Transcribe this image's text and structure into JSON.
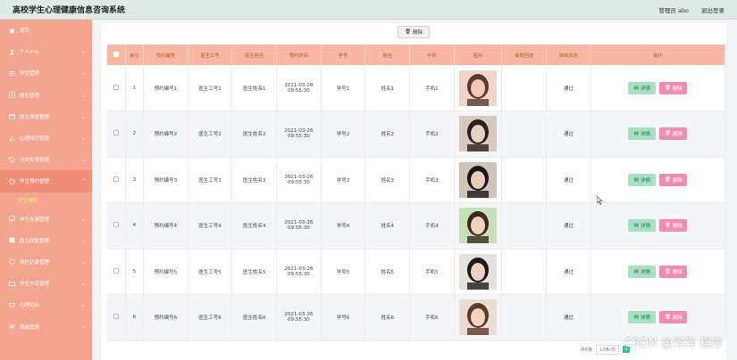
{
  "header": {
    "title": "高校学生心理健康信息咨询系统",
    "user": "管理员 abo",
    "logout": "退出登录"
  },
  "sidebar": {
    "items": [
      {
        "label": "首页",
        "icon": "home-icon"
      },
      {
        "label": "个人中心",
        "icon": "user-icon"
      },
      {
        "label": "学生管理",
        "icon": "list-icon"
      },
      {
        "label": "医生管理",
        "icon": "doctor-icon"
      },
      {
        "label": "医生排班管理",
        "icon": "calendar-icon"
      },
      {
        "label": "心理知识管理",
        "icon": "chart-icon"
      },
      {
        "label": "分类标签管理",
        "icon": "tag-icon"
      },
      {
        "label": "学生预约管理",
        "icon": "clock-icon",
        "open": true
      },
      {
        "label": "学生反馈管理",
        "icon": "message-icon"
      },
      {
        "label": "医生回复管理",
        "icon": "reply-icon"
      },
      {
        "label": "相约记录管理",
        "icon": "record-icon"
      },
      {
        "label": "学生分享管理",
        "icon": "share-icon"
      },
      {
        "label": "心理论坛",
        "icon": "forum-icon"
      },
      {
        "label": "系统管理",
        "icon": "settings-icon"
      }
    ],
    "open_sub": "学生预约"
  },
  "toolbar": {
    "delete_label": "删除"
  },
  "table": {
    "columns": [
      "索引",
      "预约编号",
      "医生工号",
      "医生姓名",
      "预约时间",
      "学号",
      "姓名",
      "手机",
      "图片",
      "审核回复",
      "审核状态",
      "操作"
    ],
    "rows": [
      {
        "index": "1",
        "booking_no": "预约编号1",
        "doctor_id": "医生工号1",
        "doctor_name": "医生姓名1",
        "time": "2021-03-26 09:55:30",
        "student_no": "学号1",
        "name": "姓名1",
        "phone": "手机1",
        "reply": "",
        "status": "通过"
      },
      {
        "index": "2",
        "booking_no": "预约编号2",
        "doctor_id": "医生工号2",
        "doctor_name": "医生姓名2",
        "time": "2021-03-26 09:55:30",
        "student_no": "学号2",
        "name": "姓名2",
        "phone": "手机2",
        "reply": "",
        "status": "通过"
      },
      {
        "index": "3",
        "booking_no": "预约编号3",
        "doctor_id": "医生工号3",
        "doctor_name": "医生姓名3",
        "time": "2021-03-26 09:55:30",
        "student_no": "学号3",
        "name": "姓名3",
        "phone": "手机3",
        "reply": "",
        "status": "通过"
      },
      {
        "index": "4",
        "booking_no": "预约编号4",
        "doctor_id": "医生工号4",
        "doctor_name": "医生姓名4",
        "time": "2021-03-26 09:55:30",
        "student_no": "学号4",
        "name": "姓名4",
        "phone": "手机4",
        "reply": "",
        "status": "通过"
      },
      {
        "index": "5",
        "booking_no": "预约编号5",
        "doctor_id": "医生工号5",
        "doctor_name": "医生姓名5",
        "time": "2021-03-26 09:55:30",
        "student_no": "学号5",
        "name": "姓名5",
        "phone": "手机5",
        "reply": "",
        "status": "通过"
      },
      {
        "index": "6",
        "booking_no": "预约编号6",
        "doctor_id": "医生工号6",
        "doctor_name": "医生姓名6",
        "time": "2021-03-26 09:55:30",
        "student_no": "学号6",
        "name": "姓名6",
        "phone": "手机6",
        "reply": "",
        "status": "通过"
      }
    ],
    "detail_label": "详情",
    "delete_label": "删除"
  },
  "pager": {
    "total": "共6条",
    "page_size": "10条/页",
    "page": "1"
  },
  "watermark": "CSDN @洋洋 程序",
  "colors": {
    "sidebar": "#f4a590",
    "header_bg": "#f7b7a3",
    "detail_btn": "#a7e1c4",
    "delete_btn": "#f08cb2"
  }
}
